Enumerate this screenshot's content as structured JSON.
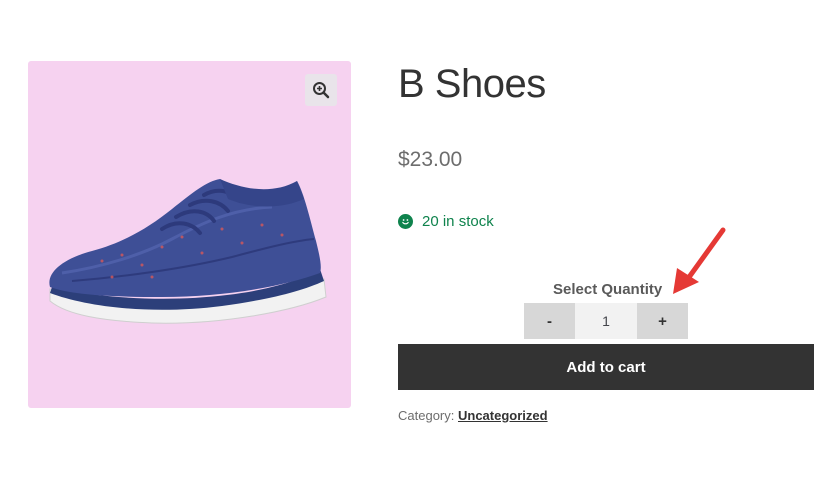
{
  "product": {
    "title": "B Shoes",
    "price": "$23.00",
    "stock_text": "20 in stock",
    "image_alt": "Blue knit running shoe"
  },
  "gallery": {
    "zoom_icon": "zoom-in-icon",
    "background_color": "#f6d2f0"
  },
  "quantity": {
    "label": "Select Quantity",
    "minus_label": "-",
    "plus_label": "+",
    "value": "1"
  },
  "cart": {
    "add_label": "Add to cart"
  },
  "meta": {
    "category_label": "Category:",
    "category_value": "Uncategorized"
  },
  "annotation": {
    "arrow_color": "#e53935",
    "arrow_icon": "red-arrow-icon"
  },
  "colors": {
    "stock": "#0f834d",
    "button": "#333333",
    "qty_button": "#d7d7d7"
  }
}
